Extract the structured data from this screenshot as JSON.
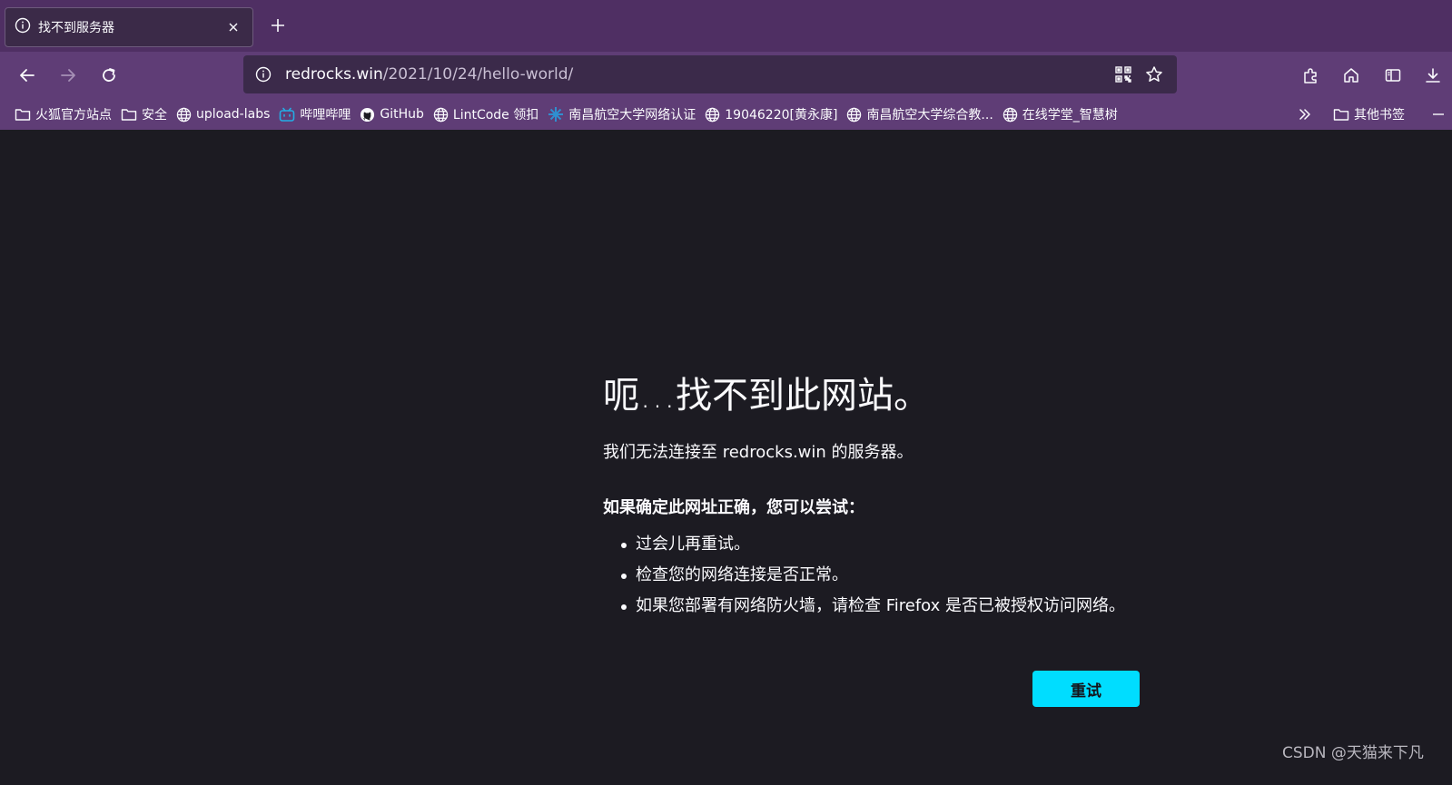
{
  "tab": {
    "title": "找不到服务器",
    "close_icon": "close-icon",
    "info_icon": "info-icon"
  },
  "toolbar": {
    "new_tab_icon": "plus-icon",
    "back_icon": "arrow-left-icon",
    "forward_icon": "arrow-right-icon",
    "reload_icon": "reload-icon",
    "right_icons": [
      "extensions-icon",
      "home-icon",
      "sidebar-icon",
      "download-icon"
    ]
  },
  "urlbar": {
    "host": "redrocks.win",
    "path": "/2021/10/24/hello-world/",
    "icons": [
      "qr-code-icon",
      "star-icon"
    ]
  },
  "bookmarks": {
    "items": [
      {
        "label": "火狐官方站点",
        "icon": "folder-icon"
      },
      {
        "label": "安全",
        "icon": "folder-icon"
      },
      {
        "label": "upload-labs",
        "icon": "globe-icon"
      },
      {
        "label": "哔哩哔哩",
        "icon": "bilibili-icon"
      },
      {
        "label": "GitHub",
        "icon": "github-icon"
      },
      {
        "label": "LintCode 领扣",
        "icon": "globe-icon"
      },
      {
        "label": "南昌航空大学网络认证",
        "icon": "network-icon"
      },
      {
        "label": "19046220[黄永康]",
        "icon": "globe-icon"
      },
      {
        "label": "南昌航空大学综合教...",
        "icon": "globe-icon"
      },
      {
        "label": "在线学堂_智慧树",
        "icon": "globe-icon"
      }
    ],
    "overflow_icon": "chevrons-right-icon",
    "other_label": "其他书签",
    "dash_icon": "minus-icon"
  },
  "error_page": {
    "title": "呃…找不到此网站。",
    "description": "我们无法连接至 redrocks.win 的服务器。",
    "subheading": "如果确定此网址正确，您可以尝试：",
    "suggestions": [
      "过会儿再重试。",
      "检查您的网络连接是否正常。",
      "如果您部署有网络防火墙，请检查 Firefox 是否已被授权访问网络。"
    ],
    "retry_label": "重试"
  },
  "watermark": "CSDN @天猫来下凡",
  "colors": {
    "tabstrip": "#4f2f63",
    "navbar": "#5f3d76",
    "content_bg": "#1c1b22",
    "accent": "#00ddff"
  }
}
